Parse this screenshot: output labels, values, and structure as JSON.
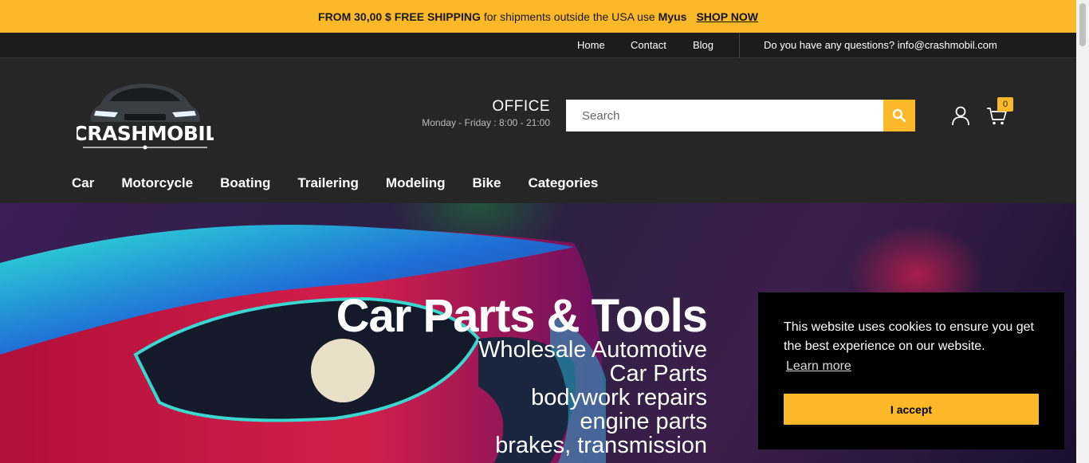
{
  "promo": {
    "lead": "FROM 30,00 $ FREE SHIPPING",
    "middle": "for shipments outside the USA use",
    "brand": "Myus",
    "cta": "SHOP NOW"
  },
  "topnav": {
    "links": [
      "Home",
      "Contact",
      "Blog"
    ],
    "contact": "Do you have any questions? info@crashmobil.com"
  },
  "header": {
    "logo_text": "CRASHMOBIL",
    "office_title": "OFFICE",
    "office_hours": "Monday - Friday : 8:00 - 21:00",
    "search_placeholder": "Search",
    "cart_count": "0"
  },
  "mainnav": {
    "items": [
      "Car",
      "Motorcycle",
      "Boating",
      "Trailering",
      "Modeling",
      "Bike",
      "Categories"
    ]
  },
  "hero": {
    "title": "Car Parts & Tools",
    "lines": [
      "Wholesale Automotive",
      "Car Parts",
      "bodywork repairs",
      "engine parts",
      "brakes, transmission"
    ]
  },
  "cookie": {
    "message": "This website uses cookies to ensure you get the best experience on our website.",
    "learn_more": "Learn more",
    "accept": "I accept"
  },
  "colors": {
    "accent": "#fbb829",
    "header_bg": "#262626",
    "topnav_bg": "#1c1c1c"
  }
}
